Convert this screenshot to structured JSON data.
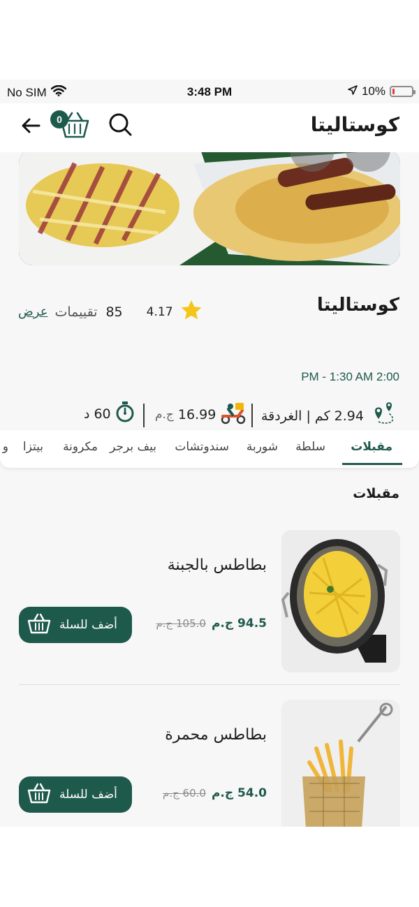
{
  "status_bar": {
    "carrier": "No SIM",
    "time": "3:48 PM",
    "battery": "10%",
    "battery_level": 0.1,
    "battery_color": "#e23b3b"
  },
  "header": {
    "title": "كوستاليتا",
    "cart_count": "0",
    "icons": [
      "back-arrow-icon",
      "cart-basket-icon",
      "search-icon"
    ]
  },
  "restaurant": {
    "name": "كوستاليتا",
    "rating": "4.17",
    "reviews_count": "85",
    "reviews_label": "تقييمات",
    "show_link": "عرض",
    "hours": "PM - 1:30 AM 2:00",
    "distance": "2.94 كم | الغردقة",
    "delivery_fee": "16.99",
    "currency": "ج.م",
    "delivery_time": "60",
    "time_unit": "د"
  },
  "tabs": [
    "مقبلات",
    "سلطة",
    "شوربة",
    "سندوتشات",
    "بيف برجر",
    "مكرونة",
    "بيتزا",
    "و"
  ],
  "active_tab": "مقبلات",
  "section_title": "مقبلات",
  "items": [
    {
      "name": "بطاطس بالجبنة",
      "price": "94.5 ج.م",
      "old_price": "105.0 ج.م",
      "button": "أضف للسلة"
    },
    {
      "name": "بطاطس محمرة",
      "price": "54.0 ج.م",
      "old_price": "60.0 ج.م",
      "button": "أضف للسلة"
    }
  ],
  "colors": {
    "brand": "#1e5a4c",
    "star": "#f5c518",
    "background": "#f7f7f7"
  }
}
